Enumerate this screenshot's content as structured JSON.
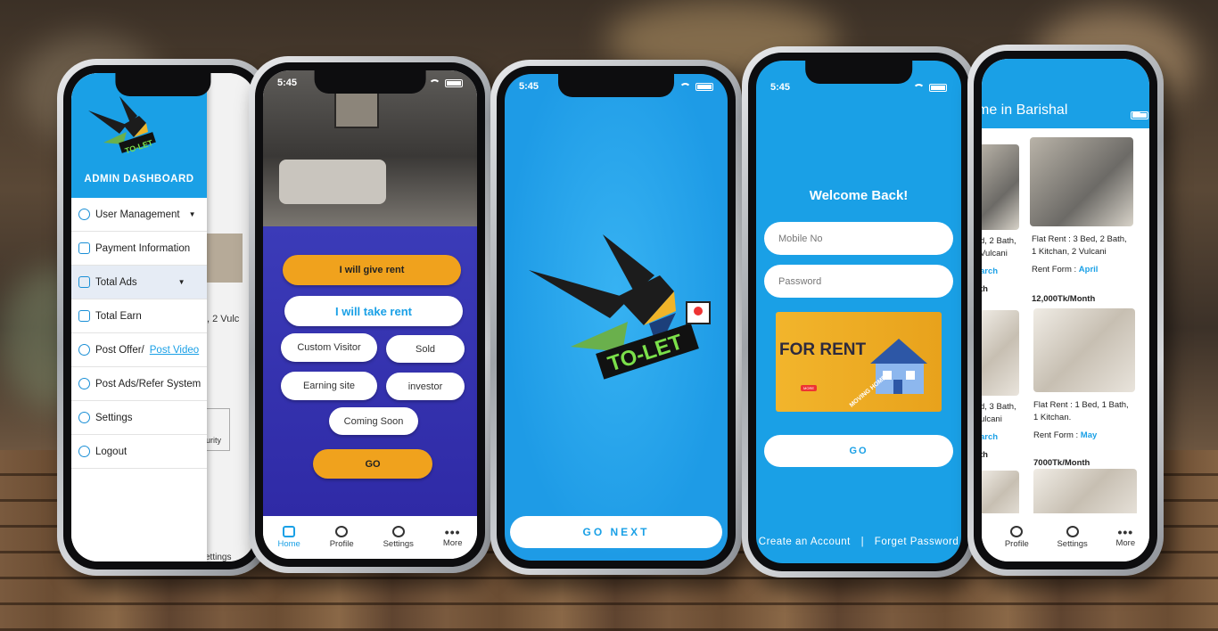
{
  "status": {
    "time": "5:45"
  },
  "admin": {
    "title": "ADMIN DASHBOARD",
    "logo_text": "TO-LET",
    "menu": [
      {
        "label": "User Management",
        "caret": true
      },
      {
        "label": "Payment Information"
      },
      {
        "label": "Total Ads",
        "caret": true
      },
      {
        "label": "Total Earn"
      },
      {
        "label": "Post Offer/",
        "link": "Post Video"
      },
      {
        "label": "Post Ads/Refer System"
      },
      {
        "label": "Settings"
      },
      {
        "label": "Logout"
      }
    ],
    "background_text": ", 2 Vulc",
    "security_label": "urity",
    "settings_label": "ettings"
  },
  "options": {
    "give_rent": "I will give rent",
    "take_rent": "I will  take rent",
    "custom_visitor": "Custom Visitor",
    "sold": "Sold",
    "earning_site": "Earning site",
    "investor": "investor",
    "coming_soon": "Coming Soon",
    "go": "GO",
    "tabs": [
      "Home",
      "Profile",
      "Settings",
      "More"
    ]
  },
  "splash": {
    "logo_text": "TO-LET",
    "go_next": "GO NEXT"
  },
  "login": {
    "welcome": "Welcome Back!",
    "mobile_placeholder": "Mobile No",
    "password_placeholder": "Password",
    "banner_title": "FOR RENT",
    "banner_more": "MORE",
    "banner_side": "MOVING HOME",
    "go": "GO",
    "create_account": "Create an Account",
    "separator": "|",
    "forget_password": "Forget Password"
  },
  "listing": {
    "header": "me in Barishal",
    "left_partial_1": {
      "l1": "d, 2 Bath,",
      "l2": "Vulcani",
      "l3": "arch",
      "price": "th"
    },
    "left_partial_2": {
      "l1": "d, 3 Bath,",
      "l2": "ulcani",
      "l3": "arch",
      "price": "th"
    },
    "cards": [
      {
        "l1": "Flat Rent : 3 Bed, 2 Bath,",
        "l2": "1 Kitchan, 2 Vulcani",
        "rent_label": "Rent Form :",
        "month": "April",
        "price": "12,000Tk/Month"
      },
      {
        "l1": "Flat Rent : 1 Bed, 1 Bath,",
        "l2": "1 Kitchan.",
        "rent_label": "Rent Form :",
        "month": "May",
        "price": "7000Tk/Month"
      }
    ],
    "tabs": [
      "Profile",
      "Settings",
      "More"
    ]
  }
}
